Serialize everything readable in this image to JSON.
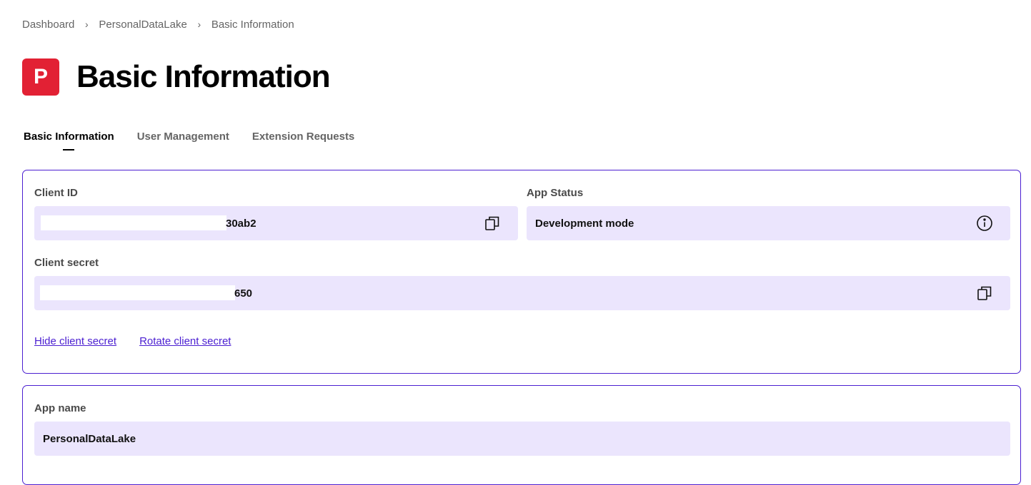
{
  "breadcrumb": {
    "items": [
      "Dashboard",
      "PersonalDataLake"
    ],
    "separator": ">",
    "current": "Basic Information"
  },
  "header": {
    "logo_letter": "P",
    "logo_color": "#e22134",
    "title": "Basic Information"
  },
  "tabs": [
    {
      "label": "Basic Information",
      "active": true
    },
    {
      "label": "User Management",
      "active": false
    },
    {
      "label": "Extension Requests",
      "active": false
    }
  ],
  "credentials": {
    "client_id": {
      "label": "Client ID",
      "value_visible_suffix": "30ab2",
      "icon": "copy-icon"
    },
    "app_status": {
      "label": "App Status",
      "value": "Development mode",
      "icon": "info-icon"
    },
    "client_secret": {
      "label": "Client secret",
      "value_visible_suffix": "650",
      "icon": "copy-icon"
    },
    "links": {
      "hide_secret": "Hide client secret",
      "rotate_secret": "Rotate client secret"
    }
  },
  "app_details": {
    "app_name": {
      "label": "App name",
      "value": "PersonalDataLake"
    }
  },
  "colors": {
    "accent": "#4b1fd1",
    "field_background": "#ebe5fd",
    "logo": "#e22134"
  }
}
